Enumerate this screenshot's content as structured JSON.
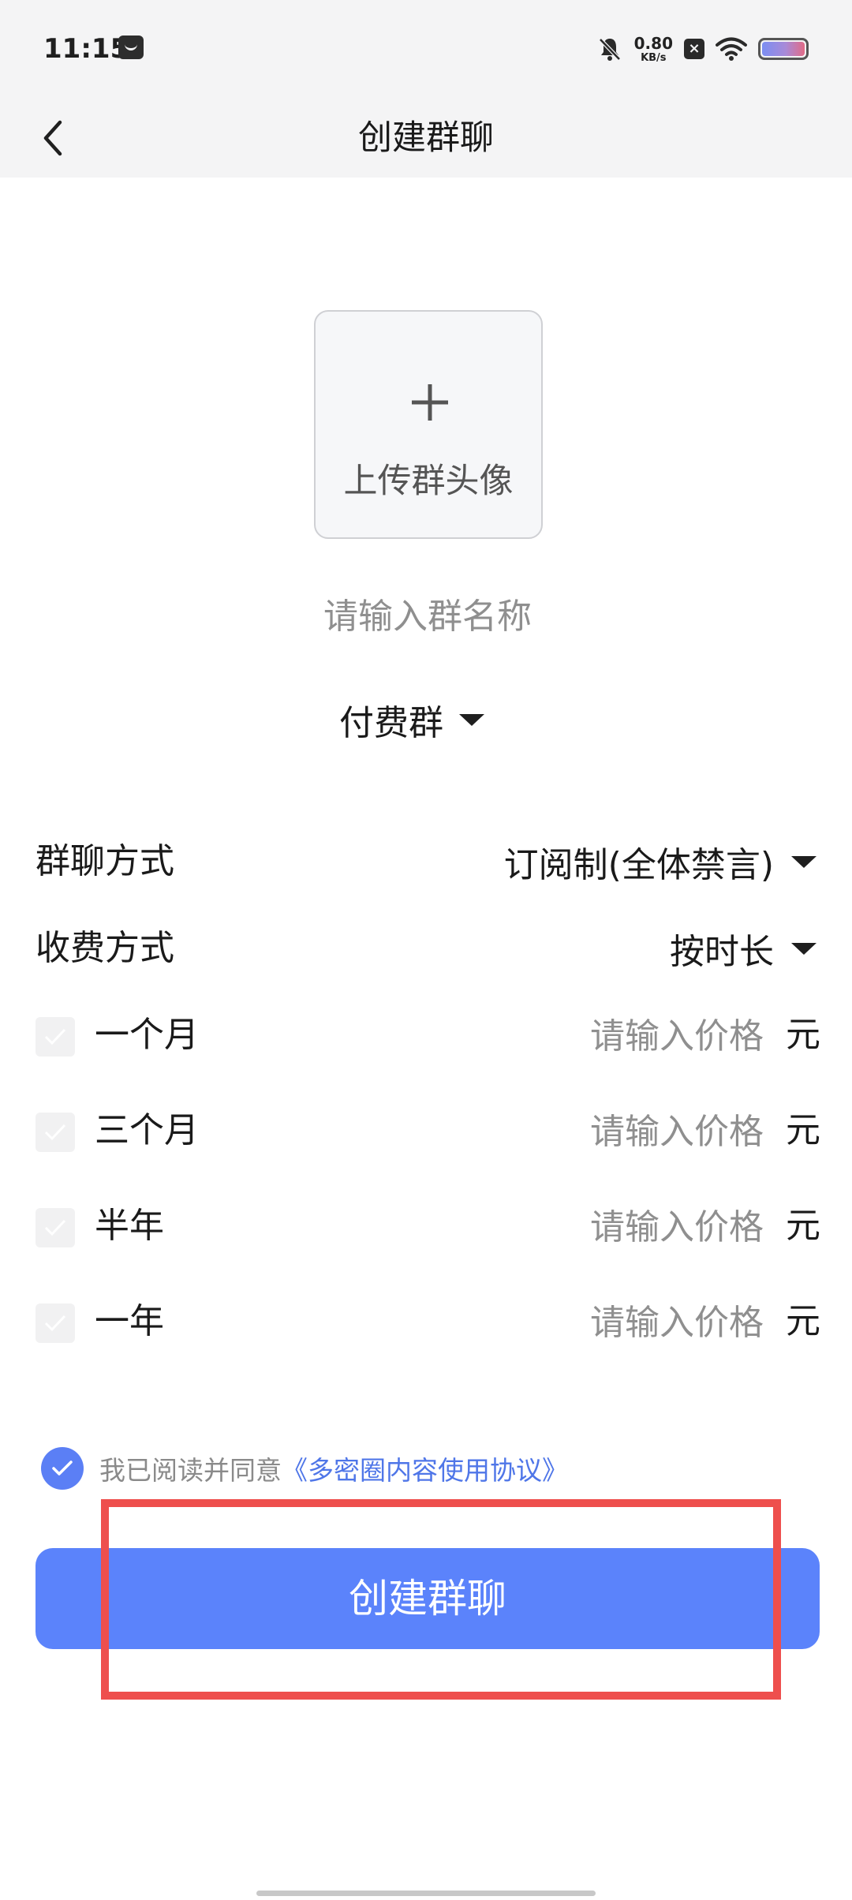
{
  "status_bar": {
    "time": "11:15",
    "net_speed_value": "0.80",
    "net_speed_unit": "KB/s",
    "icons": [
      "message-icon",
      "mute-icon",
      "close-box-icon",
      "wifi-icon",
      "battery-icon"
    ]
  },
  "nav": {
    "title": "创建群聊",
    "back_icon": "chevron-left-icon"
  },
  "avatar": {
    "label": "上传群头像",
    "icon": "plus-icon"
  },
  "group_name": {
    "value": "",
    "placeholder": "请输入群名称"
  },
  "group_type": {
    "selected": "付费群"
  },
  "settings": {
    "chat_mode_label": "群聊方式",
    "chat_mode_value": "订阅制(全体禁言)",
    "charge_mode_label": "收费方式",
    "charge_mode_value": "按时长"
  },
  "price_options": [
    {
      "label": "一个月",
      "placeholder": "请输入价格",
      "unit": "元",
      "checked": false
    },
    {
      "label": "三个月",
      "placeholder": "请输入价格",
      "unit": "元",
      "checked": false
    },
    {
      "label": "半年",
      "placeholder": "请输入价格",
      "unit": "元",
      "checked": false
    },
    {
      "label": "一年",
      "placeholder": "请输入价格",
      "unit": "元",
      "checked": false
    }
  ],
  "agreement": {
    "checked": true,
    "text": "我已阅读并同意",
    "link": "《多密圈内容使用协议》"
  },
  "submit": {
    "label": "创建群聊"
  },
  "colors": {
    "accent": "#5b83fb",
    "link": "#4f76e8",
    "highlight": "#ee4f4d",
    "header_bg": "#f4f4f5"
  }
}
